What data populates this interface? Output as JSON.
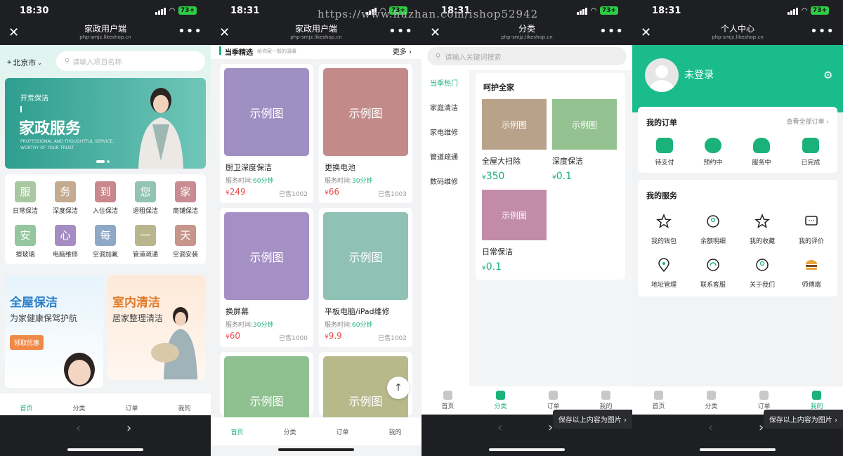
{
  "watermark": "https://www.huzhan.com/ishop52942",
  "status": {
    "time": "18:30",
    "time2": "18:31",
    "battery": "73+"
  },
  "screen1": {
    "nav_title": "家政用户端",
    "nav_url": "php-smjz.likeshop.cn",
    "city": "北京市",
    "search_placeholder": "请输入项目名称",
    "banner": {
      "small": "开荒保洁",
      "big": "家政服务",
      "sub": "PROFESSIONAL AND THOUGHTFUL SERVICE, WORTHY OF YOUR TRUST"
    },
    "grid": [
      {
        "char": "服",
        "label": "日常保洁",
        "color": "#a9c7a1"
      },
      {
        "char": "务",
        "label": "深度保洁",
        "color": "#c4aa8e"
      },
      {
        "char": "到",
        "label": "入住保洁",
        "color": "#c9888c"
      },
      {
        "char": "您",
        "label": "退租保洁",
        "color": "#93c3b2"
      },
      {
        "char": "家",
        "label": "商铺保洁",
        "color": "#c98c93"
      },
      {
        "char": "安",
        "label": "擦玻璃",
        "color": "#95c69f"
      },
      {
        "char": "心",
        "label": "电脑维修",
        "color": "#a58cc2"
      },
      {
        "char": "每",
        "label": "空调加氟",
        "color": "#8ea9c6"
      },
      {
        "char": "一",
        "label": "管道疏通",
        "color": "#b9b68e"
      },
      {
        "char": "天",
        "label": "空调安装",
        "color": "#c7968a"
      }
    ],
    "promo1": {
      "title": "全屋保洁",
      "sub": "为家健康保驾护航",
      "btn": "领取优惠"
    },
    "promo2": {
      "title": "室内清洁",
      "sub": "居家整理清洁"
    },
    "tabs": [
      "首页",
      "分类",
      "订单",
      "我的"
    ]
  },
  "screen2": {
    "nav_title": "家政用户端",
    "nav_url": "php-smjz.likeshop.cn",
    "section_title": "当季精选",
    "section_sub": "给你家一般的温暖",
    "more": "更多",
    "time_label": "服务时间:",
    "products": [
      {
        "img": "示例图",
        "name": "厨卫深度保洁",
        "minutes": "60分钟",
        "price": "249",
        "sold": "已售1002",
        "color": "#a08fc2"
      },
      {
        "img": "示例图",
        "name": "更换电池",
        "minutes": "30分钟",
        "price": "66",
        "sold": "已售1003",
        "color": "#c28b8a"
      },
      {
        "img": "示例图",
        "name": "换屏幕",
        "minutes": "30分钟",
        "price": "60",
        "sold": "已售1000",
        "color": "#a590c6"
      },
      {
        "img": "示例图",
        "name": "平板电脑/iPad维修",
        "minutes": "60分钟",
        "price": "9.9",
        "sold": "已售1002",
        "color": "#8fc1b4"
      },
      {
        "img": "示例图",
        "color": "#8fc08f"
      },
      {
        "img": "示例图",
        "color": "#b8b98b"
      }
    ],
    "tabs": [
      "首页",
      "分类",
      "订单",
      "我的"
    ]
  },
  "screen3": {
    "nav_title": "分类",
    "nav_url": "php-smjz.likeshop.cn",
    "search_placeholder": "请输入关键词搜索",
    "categories": [
      "当季热门",
      "家庭清洁",
      "家电维修",
      "管道疏通",
      "数码维修"
    ],
    "subtitle": "呵护全家",
    "items": [
      {
        "img": "示例图",
        "name": "全屋大扫除",
        "price": "350",
        "color": "#b9a28a"
      },
      {
        "img": "示例图",
        "name": "深度保洁",
        "price": "0.1",
        "color": "#93c290"
      },
      {
        "img": "示例图",
        "name": "日常保洁",
        "price": "0.1",
        "color": "#c28ca9"
      }
    ],
    "save_label": "保存以上内容为图片",
    "tabs": [
      "首页",
      "分类",
      "订单",
      "我的"
    ]
  },
  "screen4": {
    "nav_title": "个人中心",
    "nav_url": "php-smjz.likeshop.cn",
    "login": "未登录",
    "orders_title": "我的订单",
    "orders_more": "查看全部订单",
    "orders": [
      "待支付",
      "预约中",
      "服务中",
      "已完成"
    ],
    "services_title": "我的服务",
    "services": [
      "我的钱包",
      "余额明细",
      "我的收藏",
      "我的评价",
      "地址管理",
      "联系客服",
      "关于我们",
      "师傅端"
    ],
    "save_label": "保存以上内容为图片",
    "tabs": [
      "首页",
      "分类",
      "订单",
      "我的"
    ]
  },
  "colors": {
    "accent": "#1ab27a",
    "price": "#e94a4a"
  }
}
